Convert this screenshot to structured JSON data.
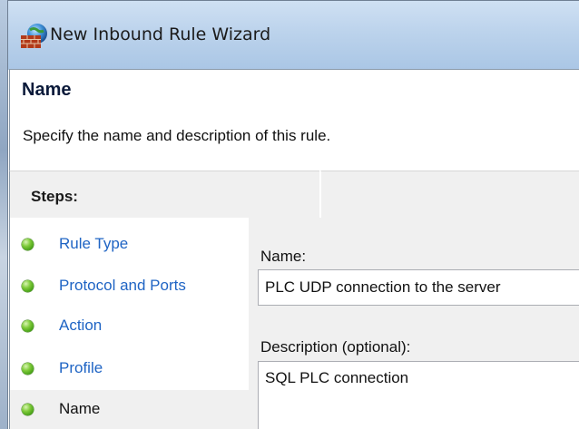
{
  "window": {
    "title": "New Inbound Rule Wizard",
    "icon": "firewall-globe-icon"
  },
  "header": {
    "title": "Name",
    "subtitle": "Specify the name and description of this rule."
  },
  "steps": {
    "title": "Steps:",
    "items": [
      {
        "label": "Rule Type",
        "state": "completed"
      },
      {
        "label": "Protocol and Ports",
        "state": "completed"
      },
      {
        "label": "Action",
        "state": "completed"
      },
      {
        "label": "Profile",
        "state": "completed"
      },
      {
        "label": "Name",
        "state": "current"
      }
    ]
  },
  "form": {
    "name_label": "Name:",
    "name_value": "PLC UDP connection to the server",
    "description_label": "Description (optional):",
    "description_value": "SQL PLC connection"
  },
  "colors": {
    "link": "#1f64c4",
    "step_dot": "#5bb024",
    "panel_bg": "#f0f0f0",
    "titlebar": "#bcd3ec"
  }
}
